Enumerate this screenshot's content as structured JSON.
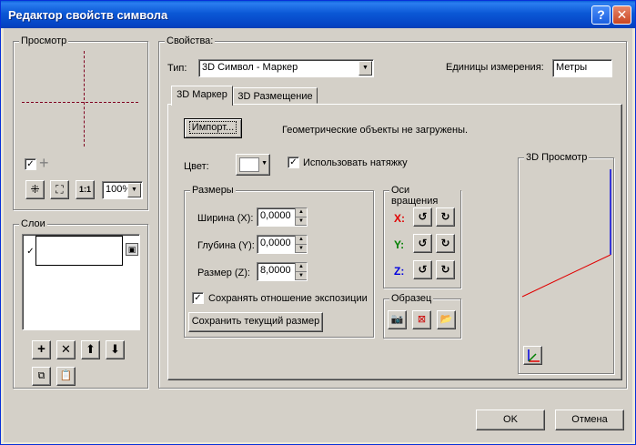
{
  "window": {
    "title": "Редактор свойств символа",
    "help": "?",
    "close": "✕"
  },
  "preview": {
    "legend": "Просмотр",
    "zoom": "100%",
    "fit_label": "1:1"
  },
  "layers": {
    "legend": "Слои"
  },
  "props": {
    "legend": "Свойства:",
    "type_label": "Тип:",
    "type_value": "3D Символ - Маркер",
    "units_label": "Единицы измерения:",
    "units_value": "Метры",
    "tabs": [
      "3D Маркер",
      "3D Размещение"
    ],
    "import_button": "Импорт...",
    "import_status": "Геометрические объекты не загружены.",
    "color_label": "Цвет:",
    "use_texture": "Использовать натяжку",
    "sizes": {
      "legend": "Размеры",
      "width_label": "Ширина (X):",
      "width_value": "0,0000",
      "depth_label": "Глубина (Y):",
      "depth_value": "0,0000",
      "size_label": "Размер (Z):",
      "size_value": "8,0000",
      "keep_ratio": "Сохранять отношение экспозиции",
      "save_size": "Сохранить текущий размер"
    },
    "rotation": {
      "legend": "Оси вращения",
      "x": "X:",
      "y": "Y:",
      "z": "Z:"
    },
    "sample": {
      "legend": "Образец"
    },
    "preview3d": {
      "legend": "3D Просмотр"
    }
  },
  "footer": {
    "ok": "OK",
    "cancel": "Отмена"
  },
  "colors": {
    "x_axis": "#e00000",
    "y_axis": "#008000",
    "z_axis": "#0000e0"
  }
}
